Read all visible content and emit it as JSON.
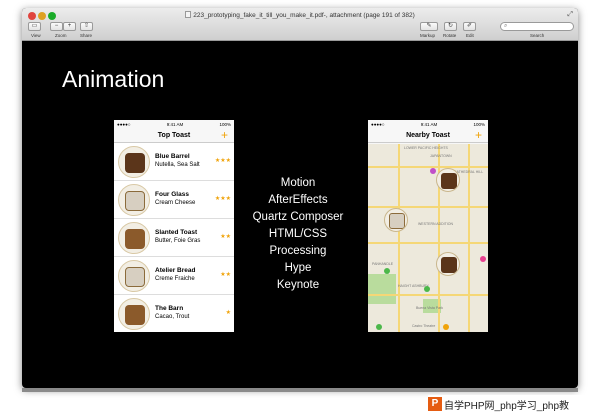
{
  "window": {
    "title": "223_prototyping_fake_it_till_you_make_it.pdf‑, attachment (page 191 of 382)"
  },
  "toolbar": {
    "labels": [
      "View",
      "Zoom",
      "Share",
      "Markup",
      "Rotate",
      "Edit",
      "Search"
    ],
    "search_placeholder": ""
  },
  "slide": {
    "title": "Animation",
    "tools": [
      "Motion",
      "AfterEffects",
      "Quartz Composer",
      "HTML/CSS",
      "Processing",
      "Hype",
      "Keynote"
    ]
  },
  "left_phone": {
    "time": "9:41 AM",
    "battery": "100%",
    "title": "Top Toast",
    "items": [
      {
        "name": "Blue Barrel",
        "sub": "Nutella, Sea Salt",
        "stars": "★★★"
      },
      {
        "name": "Four Glass",
        "sub": "Cream Cheese",
        "stars": "★★★"
      },
      {
        "name": "Slanted Toast",
        "sub": "Butter, Foie Gras",
        "stars": "★★"
      },
      {
        "name": "Atelier Bread",
        "sub": "Creme Fraiche",
        "stars": "★★"
      },
      {
        "name": "The Barn",
        "sub": "Cacao, Trout",
        "stars": "★"
      }
    ]
  },
  "right_phone": {
    "time": "9:41 AM",
    "battery": "100%",
    "title": "Nearby Toast",
    "map_labels": [
      "LOWER PACIFIC HEIGHTS",
      "JAPANTOWN",
      "CATHEDRAL HILL",
      "WESTERN ADDITION",
      "PANHANDLE",
      "HAIGHT ASHBURY",
      "Buena Vista Park",
      "Castro Theatre"
    ]
  },
  "colors": {
    "accent": "#f0a30a"
  },
  "watermark": {
    "text": "自学PHP网_php学习_php教"
  }
}
